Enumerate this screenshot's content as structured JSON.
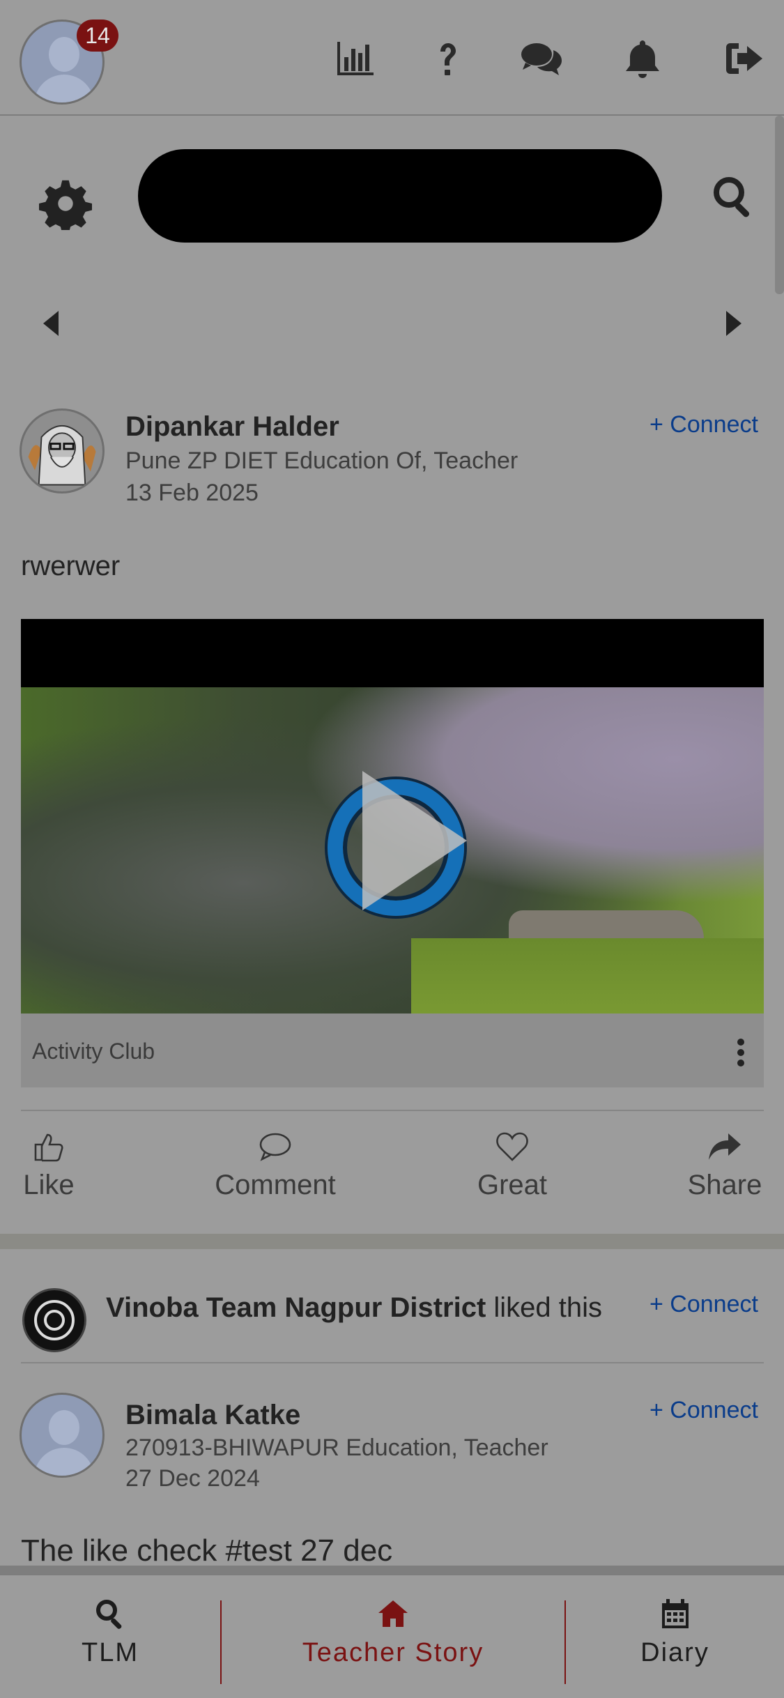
{
  "header": {
    "notification_count": "14",
    "icons": [
      "stats-chart-icon",
      "help-icon",
      "chat-icon",
      "bell-icon",
      "logout-icon"
    ]
  },
  "toolbar": {
    "settings_icon": "gear-icon",
    "search_value": "",
    "search_icon": "search-icon"
  },
  "carousel": {
    "prev_icon": "caret-left-icon",
    "next_icon": "caret-right-icon"
  },
  "posts": [
    {
      "author": "Dipankar Halder",
      "role": "Pune ZP DIET Education Of, Teacher",
      "date": "13 Feb 2025",
      "connect_label": "+ Connect",
      "text": "rwerwer",
      "club": "Activity Club",
      "actions": [
        {
          "label": "Like",
          "icon": "thumbs-up-icon"
        },
        {
          "label": "Comment",
          "icon": "comment-icon"
        },
        {
          "label": "Great",
          "icon": "heart-icon"
        },
        {
          "label": "Share",
          "icon": "share-icon"
        }
      ]
    },
    {
      "liked_by": "Vinoba Team Nagpur District",
      "liked_suffix": " liked this",
      "liked_connect_label": "+ Connect",
      "author": "Bimala Katke",
      "role": "270913-BHIWAPUR Education, Teacher",
      "date": "27 Dec 2024",
      "connect_label": "+ Connect",
      "text": "The like check #test 27 dec"
    }
  ],
  "bottom_nav": [
    {
      "label": "TLM",
      "icon": "search-icon",
      "active": false
    },
    {
      "label": "Teacher Story",
      "icon": "home-icon",
      "active": true
    },
    {
      "label": "Diary",
      "icon": "calendar-icon",
      "active": false
    }
  ],
  "colors": {
    "accent": "#7a1212",
    "link": "#0a3c8a",
    "overlay_bg": "#9c9c9c"
  }
}
